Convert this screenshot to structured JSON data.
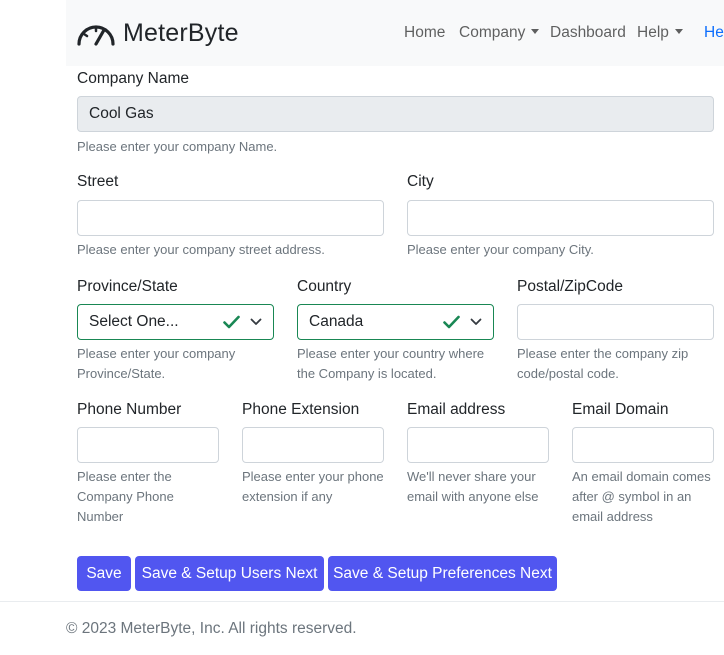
{
  "navbar": {
    "brand": "MeterByte",
    "items": [
      {
        "label": "Home"
      },
      {
        "label": "Company"
      },
      {
        "label": "Dashboard"
      },
      {
        "label": "Help"
      },
      {
        "label": "Hel"
      }
    ]
  },
  "form": {
    "company_name": {
      "label": "Company Name",
      "value": "Cool Gas",
      "help": "Please enter your company Name."
    },
    "street": {
      "label": "Street",
      "value": "",
      "help": "Please enter your company street address."
    },
    "city": {
      "label": "City",
      "value": "",
      "help": "Please enter your company City."
    },
    "province": {
      "label": "Province/State",
      "value": "Select One...",
      "help": "Please enter your company Province/State."
    },
    "country": {
      "label": "Country",
      "value": "Canada",
      "help": "Please enter your country where the Company is located."
    },
    "postal": {
      "label": "Postal/ZipCode",
      "value": "",
      "help": "Please enter the company zip code/postal code."
    },
    "phone": {
      "label": "Phone Number",
      "value": "",
      "help": "Please enter the Company Phone Number"
    },
    "extension": {
      "label": "Phone Extension",
      "value": "",
      "help": "Please enter your phone extension if any"
    },
    "email": {
      "label": "Email address",
      "value": "",
      "help": "We'll never share your email with anyone else"
    },
    "email_domain": {
      "label": "Email Domain",
      "value": "",
      "help": "An email domain comes after @ symbol in an email address"
    }
  },
  "buttons": {
    "save": "Save",
    "save_users": "Save & Setup Users Next",
    "save_prefs": "Save & Setup Preferences Next"
  },
  "colors": {
    "primary_button": "#5156f0",
    "valid_border": "#198754",
    "nav_accent": "#0d6efd"
  },
  "footer": {
    "text": "© 2023 MeterByte, Inc. All rights reserved."
  }
}
